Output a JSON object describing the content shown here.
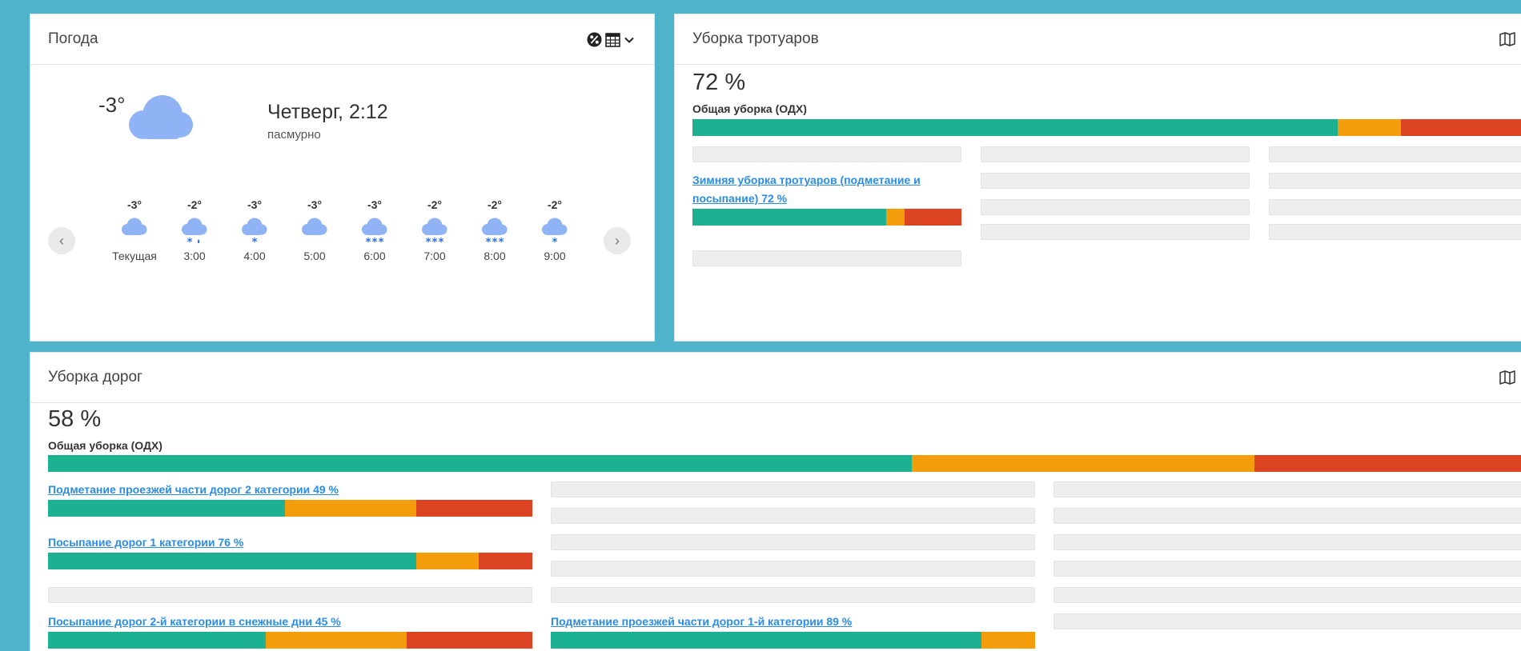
{
  "weather": {
    "title": "Погода",
    "current_temp": "-3°",
    "day_time": "Четверг, 2:12",
    "condition": "пасмурно",
    "prev_label": "‹",
    "next_label": "›",
    "hourly": [
      {
        "temp": "-3°",
        "label": "Текущая",
        "icon": "cloud-icon"
      },
      {
        "temp": "-2°",
        "label": "3:00",
        "icon": "cloud-snow-rain-icon"
      },
      {
        "temp": "-3°",
        "label": "4:00",
        "icon": "cloud-light-snow-icon"
      },
      {
        "temp": "-3°",
        "label": "5:00",
        "icon": "cloud-icon"
      },
      {
        "temp": "-3°",
        "label": "6:00",
        "icon": "cloud-snow-icon"
      },
      {
        "temp": "-2°",
        "label": "7:00",
        "icon": "cloud-snow-icon"
      },
      {
        "temp": "-2°",
        "label": "8:00",
        "icon": "cloud-snow-icon"
      },
      {
        "temp": "-2°",
        "label": "9:00",
        "icon": "cloud-light-snow-icon"
      }
    ],
    "header_icons": [
      "percent-icon",
      "calendar-icon",
      "chevron-down-icon"
    ]
  },
  "sidewalks": {
    "title": "Уборка тротуаров",
    "percent": "72 %",
    "overall_label": "Общая уборка (ОДХ)",
    "overall_bar": [
      0.76,
      0.075,
      0.165
    ],
    "item_link": "Зимняя уборка тротуаров (подметание и посыпание) 72 %",
    "item_bar": [
      0.72,
      0.07,
      0.21
    ],
    "map_icon": "map-icon"
  },
  "roads": {
    "title": "Уборка дорог",
    "percent": "58 %",
    "overall_label": "Общая уборка (ОДХ)",
    "overall_bar": [
      0.58,
      0.23,
      0.19
    ],
    "items": [
      {
        "label": "Подметание проезжей части дорог 2 категории 49 %",
        "bar": [
          0.49,
          0.27,
          0.24
        ]
      },
      {
        "label": "Посыпание дорог 1 категории 76 %",
        "bar": [
          0.76,
          0.13,
          0.11
        ]
      },
      {
        "label": "Посыпание дорог 2-й категории в снежные дни 45 %",
        "bar": [
          0.45,
          0.29,
          0.26
        ]
      },
      {
        "label": "Подметание проезжей части дорог 1-й категории 89 %",
        "bar": [
          0.89,
          0.11,
          0
        ]
      }
    ],
    "map_icon": "map-icon"
  },
  "colors": {
    "done": "#1bb191",
    "partial": "#f39c0c",
    "not_done": "#dc4322",
    "link": "#2a8ce8",
    "background": "#4fb3c9",
    "cloud": "#8fb3f5",
    "snow": "#2a6fe0"
  }
}
